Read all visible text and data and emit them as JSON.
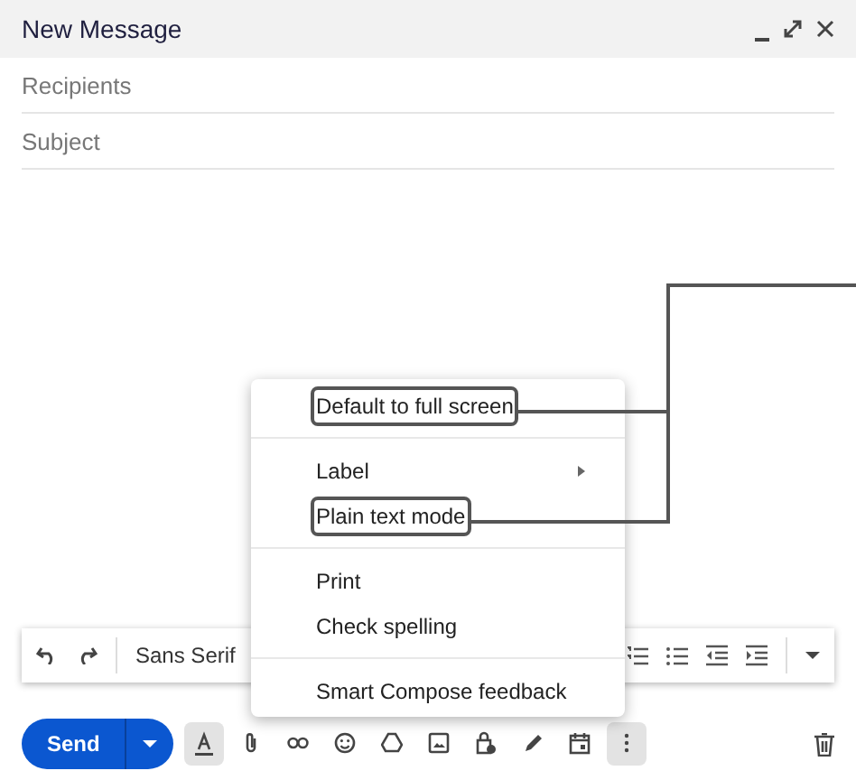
{
  "window": {
    "title": "New Message"
  },
  "fields": [
    {
      "placeholder": "Recipients"
    },
    {
      "placeholder": "Subject"
    }
  ],
  "format_toolbar": {
    "font": "Sans Serif"
  },
  "menu": {
    "groups": [
      [
        {
          "label": "Default to full screen",
          "highlighted": true,
          "has_submenu": false
        }
      ],
      [
        {
          "label": "Label",
          "highlighted": false,
          "has_submenu": true
        },
        {
          "label": "Plain text mode",
          "highlighted": true,
          "has_submenu": false
        }
      ],
      [
        {
          "label": "Print",
          "highlighted": false,
          "has_submenu": false
        },
        {
          "label": "Check spelling",
          "highlighted": false,
          "has_submenu": false
        }
      ],
      [
        {
          "label": "Smart Compose feedback",
          "highlighted": false,
          "has_submenu": false
        }
      ]
    ]
  },
  "bottom_bar": {
    "send": "Send",
    "tools": [
      {
        "kind": "formatting",
        "active": true
      },
      {
        "kind": "attach",
        "active": false
      },
      {
        "kind": "link",
        "active": false
      },
      {
        "kind": "emoji",
        "active": false
      },
      {
        "kind": "drive",
        "active": false
      },
      {
        "kind": "photo",
        "active": false
      },
      {
        "kind": "confidential",
        "active": false
      },
      {
        "kind": "signature",
        "active": false
      },
      {
        "kind": "schedule",
        "active": false
      },
      {
        "kind": "more",
        "active": true
      }
    ]
  }
}
